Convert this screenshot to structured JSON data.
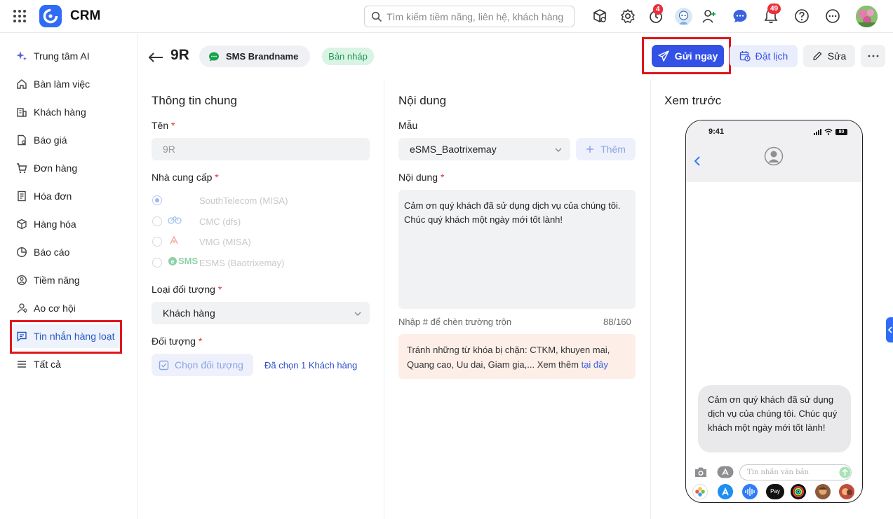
{
  "app": {
    "title": "CRM",
    "brand_color": "#2f6cf6"
  },
  "search": {
    "placeholder": "Tìm kiếm tiềm năng, liên hệ, khách hàng"
  },
  "topbar": {
    "badges": {
      "clock": "4",
      "bell": "49"
    }
  },
  "sidebar": {
    "items": [
      {
        "label": "Trung tâm AI",
        "icon": "sparkle-icon"
      },
      {
        "label": "Bàn làm việc",
        "icon": "home-icon"
      },
      {
        "label": "Khách hàng",
        "icon": "building-icon"
      },
      {
        "label": "Báo giá",
        "icon": "quote-icon"
      },
      {
        "label": "Đơn hàng",
        "icon": "cart-icon"
      },
      {
        "label": "Hóa đơn",
        "icon": "invoice-icon"
      },
      {
        "label": "Hàng hóa",
        "icon": "box-icon"
      },
      {
        "label": "Báo cáo",
        "icon": "pie-chart-icon"
      },
      {
        "label": "Tiềm năng",
        "icon": "target-icon"
      },
      {
        "label": "Ao cơ hội",
        "icon": "opportunity-icon"
      },
      {
        "label": "Tin nhắn hàng loạt",
        "icon": "message-icon",
        "active": true
      },
      {
        "label": "Tất cả",
        "icon": "menu-icon"
      }
    ]
  },
  "header": {
    "record_name": "9R",
    "channel_label": "SMS Brandname",
    "status": "Bản nháp",
    "send_now": "Gửi ngay",
    "schedule": "Đặt lịch",
    "edit": "Sửa"
  },
  "general": {
    "title": "Thông tin chung",
    "name_label": "Tên",
    "name_value": "9R",
    "provider_label": "Nhà cung cấp",
    "providers": [
      "SouthTelecom (MISA)",
      "CMC (dfs)",
      "VMG (MISA)",
      "ESMS (Baotrixemay)"
    ],
    "provider_logo_text": "SMS",
    "object_type_label": "Loại đối tượng",
    "object_type_value": "Khách hàng",
    "object_label": "Đối tượng",
    "choose_object": "Chọn đối tượng",
    "selected": "Đã chọn 1 Khách hàng"
  },
  "content": {
    "title": "Nội dung",
    "template_label": "Mẫu",
    "template_value": "eSMS_Baotrixemay",
    "add_label": "Thêm",
    "body_label": "Nội dung",
    "body_line1": "Cảm ơn quý khách đã sử dụng dịch vụ của chúng tôi.",
    "body_line2": "Chúc quý khách một ngày mới tốt lành!",
    "hint": "Nhập # để chèn trường trộn",
    "counter": "88/160",
    "warning": "Tránh những từ khóa bị chặn: CTKM, khuyen mai, Quang cao, Uu dai, Giam gia,... Xem thêm",
    "warning_link": "tại đây"
  },
  "preview": {
    "title": "Xem trước",
    "time": "9:41",
    "battery": "80",
    "message": "Cảm ơn quý khách đã sử dụng dịch vụ của chúng tôi. Chúc quý khách một ngày mới tốt lành!",
    "input_placeholder": "Tin nhắn văn bản",
    "pay_label": "Pay"
  }
}
